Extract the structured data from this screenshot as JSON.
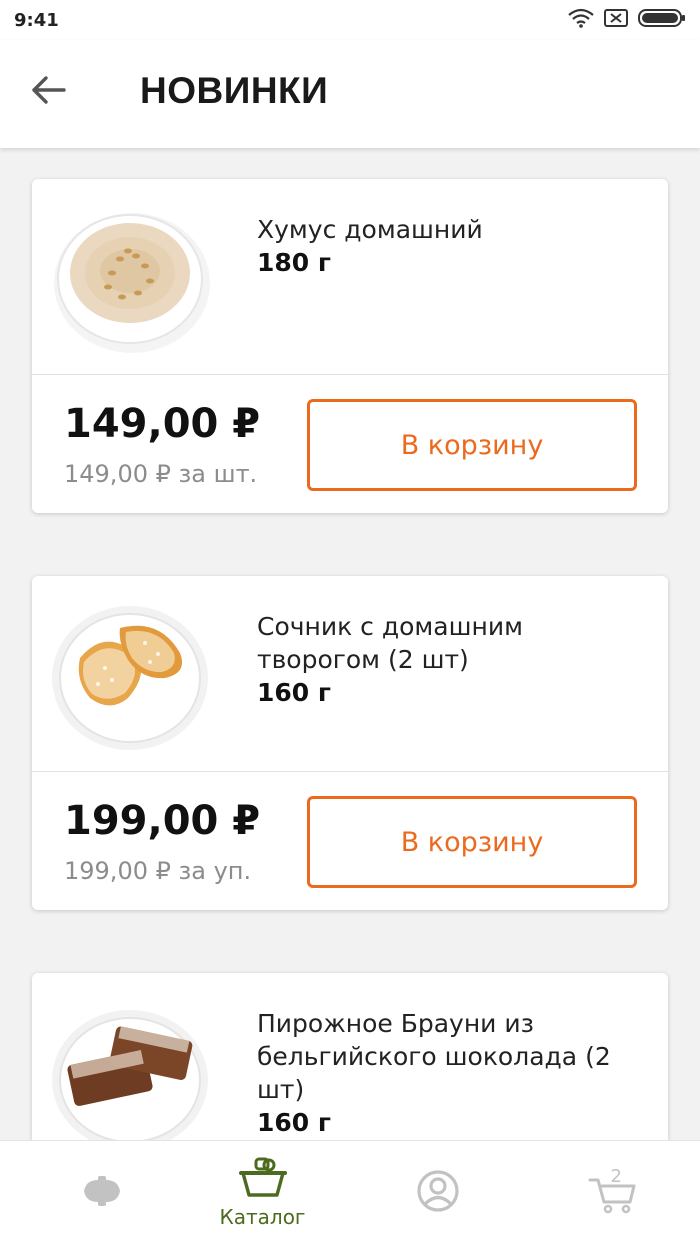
{
  "status_bar": {
    "time": "9:41"
  },
  "app_bar": {
    "title": "НОВИНКИ"
  },
  "products": [
    {
      "name": "Хумус домашний",
      "weight": "180 г",
      "price": "149,00 ₽",
      "unit_price": "149,00 ₽ за шт.",
      "button_label": "В корзину",
      "image": "hummus-bowl"
    },
    {
      "name": "Сочник с домашним творогом (2 шт)",
      "weight": "160 г",
      "price": "199,00 ₽",
      "unit_price": "199,00 ₽ за уп.",
      "button_label": "В корзину",
      "image": "sochnik-plate"
    },
    {
      "name": "Пирожное Брауни из бельгийского шоколада (2 шт)",
      "weight": "160 г",
      "image": "brownie-plate"
    }
  ],
  "bottom_nav": {
    "items": [
      {
        "icon": "brand-logo-icon",
        "label": ""
      },
      {
        "icon": "basket-icon",
        "label": "Каталог"
      },
      {
        "icon": "profile-icon",
        "label": ""
      },
      {
        "icon": "cart-icon",
        "label": "",
        "badge": "2"
      }
    ]
  },
  "colors": {
    "accent": "#ec6a1e",
    "nav_active": "#4d6b1e",
    "nav_inactive": "#c2c2c2"
  }
}
